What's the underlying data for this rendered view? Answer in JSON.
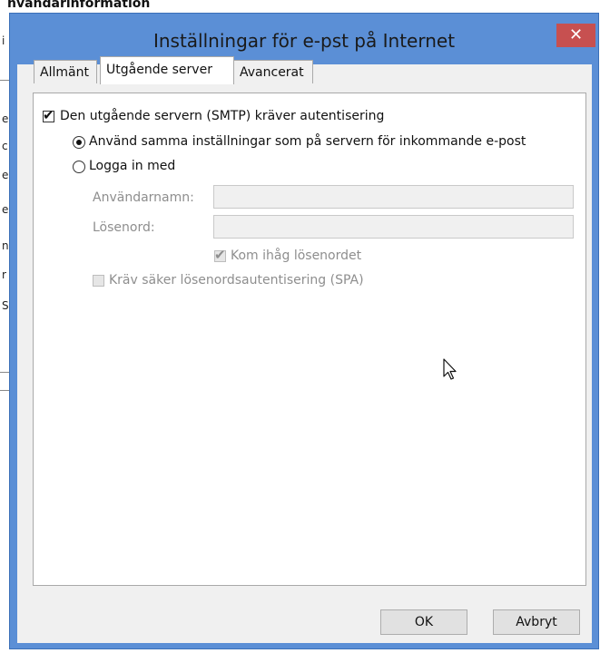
{
  "background": {
    "title_fragment": "nvändarinformation",
    "edge_chars": [
      "i",
      "i",
      "e",
      "c",
      "e",
      "e",
      "n",
      "r",
      "r",
      "S"
    ]
  },
  "dialog": {
    "title": "Inställningar för e-pst på Internet",
    "close_glyph": "✕",
    "accent_color": "#5b8fd6"
  },
  "tabs": [
    {
      "label": "Allmänt",
      "active": false
    },
    {
      "label": "Utgående server",
      "active": true
    },
    {
      "label": "Avancerat",
      "active": false
    }
  ],
  "smtp_auth": {
    "label": "Den utgående servern (SMTP) kräver autentisering",
    "checked": true
  },
  "options": {
    "same_settings_label": "Använd samma inställningar som på servern för inkommande e-post",
    "same_settings_selected": true,
    "login_with_label": "Logga in med",
    "login_with_selected": false
  },
  "login": {
    "username_label": "Användarnamn:",
    "username_value": "",
    "password_label": "Lösenord:",
    "password_value": "",
    "remember_label": "Kom ihåg lösenordet",
    "remember_checked": true,
    "spa_label": "Kräv säker lösenordsautentisering (SPA)",
    "spa_checked": false
  },
  "buttons": {
    "ok": "OK",
    "cancel": "Avbryt"
  }
}
